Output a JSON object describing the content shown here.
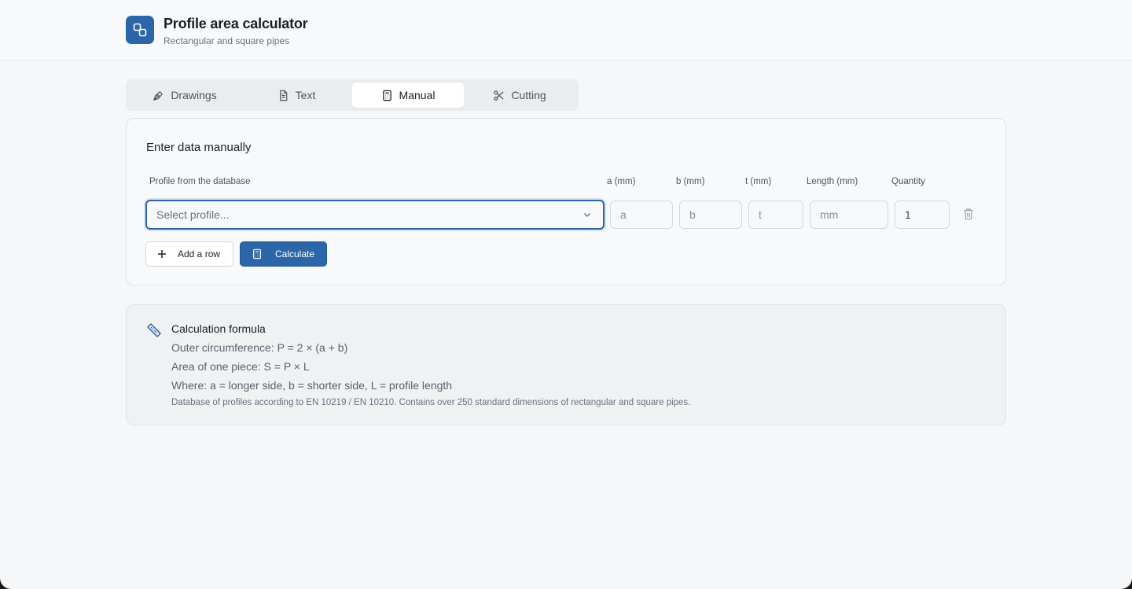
{
  "header": {
    "title": "Profile area calculator",
    "subtitle": "Rectangular and square pipes",
    "logo_icon": "linked-squares-icon",
    "accent": "#2b67a8"
  },
  "tabs": [
    {
      "label": "Drawings",
      "icon": "pen-tool-icon",
      "active": false
    },
    {
      "label": "Text",
      "icon": "file-text-icon",
      "active": false
    },
    {
      "label": "Manual",
      "icon": "calculator-icon",
      "active": true
    },
    {
      "label": "Cutting",
      "icon": "scissors-icon",
      "active": false
    }
  ],
  "manual": {
    "title": "Enter data manually",
    "columns": {
      "profile": "Profile from the database",
      "a": "a (mm)",
      "b": "b (mm)",
      "t": "t (mm)",
      "length": "Length (mm)",
      "quantity": "Quantity"
    },
    "row": {
      "profile_placeholder": "Select profile...",
      "a_placeholder": "a",
      "b_placeholder": "b",
      "t_placeholder": "t",
      "length_placeholder": "mm",
      "quantity_value": "1"
    },
    "add_row_label": "Add a row",
    "calculate_label": "Calculate"
  },
  "formula": {
    "title": "Calculation formula",
    "lines": [
      "Outer circumference: P = 2 × (a + b)",
      "Area of one piece: S = P × L",
      "Where: a = longer side, b = shorter side, L = profile length"
    ],
    "note": "Database of profiles according to EN 10219 / EN 10210. Contains over 250 standard dimensions of rectangular and square pipes."
  }
}
